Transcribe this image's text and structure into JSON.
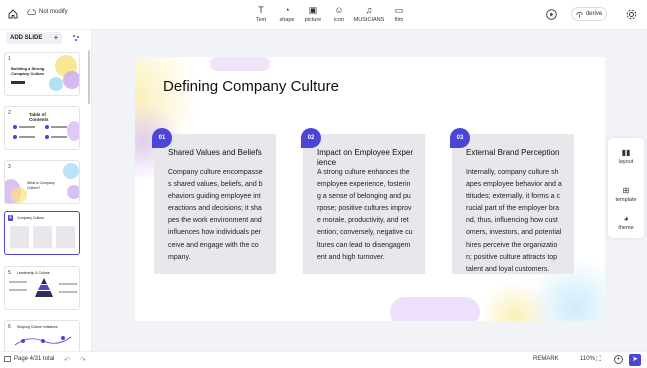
{
  "topbar": {
    "status": "Not modify",
    "tools": [
      {
        "label": "Text",
        "icon": "T"
      },
      {
        "label": "shape",
        "icon": "◔"
      },
      {
        "label": "picture",
        "icon": "▣"
      },
      {
        "label": "icon",
        "icon": "☺"
      },
      {
        "label": "MUSICIANS",
        "icon": "♫"
      },
      {
        "label": "film",
        "icon": "▭"
      }
    ],
    "derive": "derive"
  },
  "sidebar": {
    "add_slide": "ADD SLIDE",
    "add_plus": "+",
    "thumbs": [
      {
        "num": "1",
        "text": "Building a Strong Company Culture"
      },
      {
        "num": "2",
        "text": "Table of Contents"
      },
      {
        "num": "3",
        "text": "What is Company Culture?"
      },
      {
        "num": "4",
        "text": "Company Culture"
      },
      {
        "num": "5",
        "text": "Leadership & Culture"
      },
      {
        "num": "6",
        "text": "Shaping Culture Initiatives"
      }
    ]
  },
  "slide": {
    "title": "Defining Company Culture",
    "cards": [
      {
        "num": "01",
        "title": "Shared Values and Beliefs",
        "lines": [
          "Company culture encompasse",
          "s shared values, beliefs, and b",
          "ehaviors guiding employee int",
          "eractions and decisions; it sha",
          "pes the work environment and",
          " influences how individuals per",
          "ceive and engage with the co",
          "mpany."
        ]
      },
      {
        "num": "02",
        "title_lines": [
          "Impact on Employee Exper",
          "ience"
        ],
        "lines": [
          "A strong culture enhances the",
          "employee experience, fosterin",
          "g a sense of belonging and pu",
          "rpose; positive cultures improv",
          "e morale, productivity, and ret",
          "ention; conversely, negative cu",
          "ltures can lead to disengagem",
          "ent and high turnover."
        ]
      },
      {
        "num": "03",
        "title": "External Brand Perception",
        "lines": [
          "Internally, company culture sh",
          "apes employee behavior and a",
          "ttitudes; externally, it forms a c",
          "rucial part of the employer bra",
          "nd, thus, influencing how cust",
          "omers, investors, and potential",
          " hires perceive the organizatio",
          "n; positive culture attracts top",
          "talent and loyal customers."
        ]
      }
    ]
  },
  "rpanel": {
    "layout": "layout",
    "template": "template",
    "theme": "theme"
  },
  "bottombar": {
    "page_info": "Page 4/31 total",
    "remark": "REMARK",
    "zoom": "110%"
  },
  "colors": {
    "accent": "#4b46d8",
    "card_bg": "#e8e8ec",
    "canvas_bg": "#f2f3f7"
  }
}
